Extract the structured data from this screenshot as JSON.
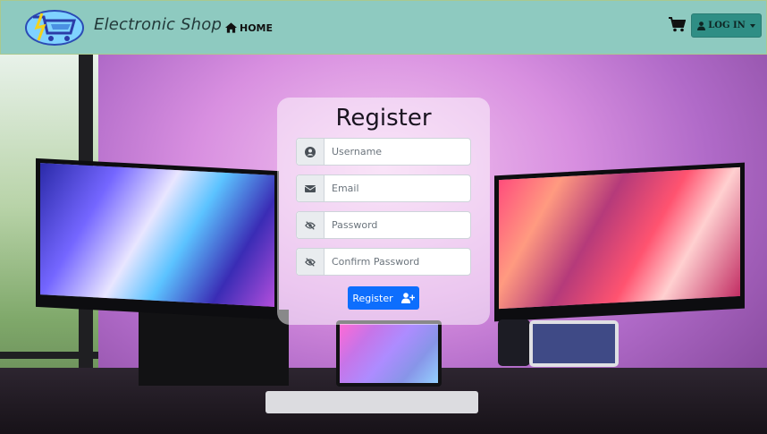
{
  "brand": {
    "name": "Electronic Shop",
    "logo_icon": "shopping-cart-lightning-logo"
  },
  "nav": {
    "home_label": "HOME",
    "home_icon": "home-icon",
    "cart_icon": "cart-icon",
    "login_label": "LOG IN",
    "login_icon": "user-icon"
  },
  "register": {
    "title": "Register",
    "fields": {
      "username_placeholder": "Username",
      "email_placeholder": "Email",
      "password_placeholder": "Password",
      "confirm_password_placeholder": "Confirm Password"
    },
    "icons": {
      "username": "user-circle-icon",
      "email": "envelope-icon",
      "password": "eye-slash-icon",
      "confirm_password": "eye-slash-icon"
    },
    "submit_label": "Register",
    "submit_icon": "user-plus-icon"
  },
  "colors": {
    "navbar_bg": "#8ecac0",
    "login_button_bg": "#2f8e85",
    "primary_button": "#0d6efd"
  }
}
